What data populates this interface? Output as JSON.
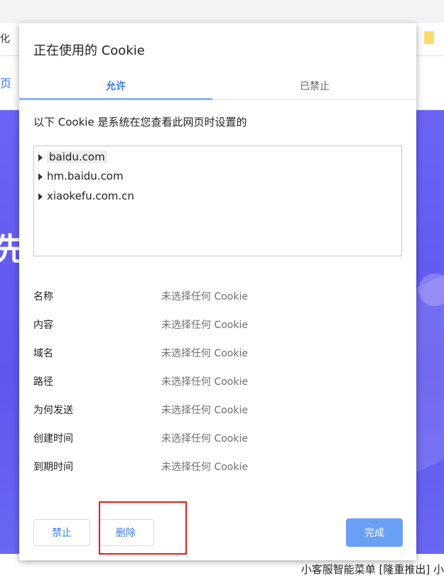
{
  "background": {
    "left_fragment_1": "化",
    "left_fragment_2": "页",
    "hero_char": "先",
    "footer_text": "小客服智能菜单 [隆重推出] 小"
  },
  "dialog": {
    "title": "正在使用的 Cookie",
    "tabs": [
      {
        "label": "允许",
        "active": true
      },
      {
        "label": "已禁止",
        "active": false
      }
    ],
    "description": "以下 Cookie 是系统在您查看此网页时设置的",
    "domains": [
      {
        "label": "baidu.com",
        "selected": true
      },
      {
        "label": "hm.baidu.com",
        "selected": false
      },
      {
        "label": "xiaokefu.com.cn",
        "selected": false
      }
    ],
    "properties": [
      {
        "name": "名称",
        "value": "未选择任何 Cookie"
      },
      {
        "name": "内容",
        "value": "未选择任何 Cookie"
      },
      {
        "name": "域名",
        "value": "未选择任何 Cookie"
      },
      {
        "name": "路径",
        "value": "未选择任何 Cookie"
      },
      {
        "name": "为何发送",
        "value": "未选择任何 Cookie"
      },
      {
        "name": "创建时间",
        "value": "未选择任何 Cookie"
      },
      {
        "name": "到期时间",
        "value": "未选择任何 Cookie"
      }
    ],
    "buttons": {
      "block_label": "禁止",
      "delete_label": "删除",
      "done_label": "完成"
    }
  },
  "colors": {
    "accent": "#3b78e7",
    "primary_button": "#6a9ff6",
    "highlight": "#e02020",
    "hero_background": "#6a64f6"
  }
}
